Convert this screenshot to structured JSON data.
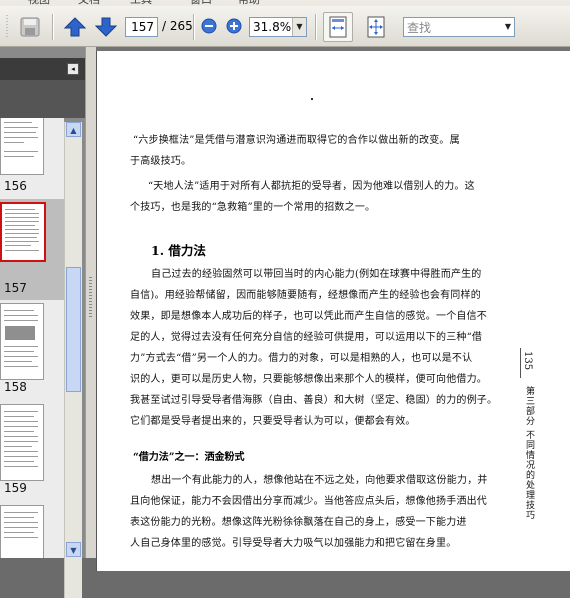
{
  "menubar": {
    "items": [
      "视图",
      "文档",
      "工具",
      "窗口",
      "帮助"
    ]
  },
  "toolbar": {
    "page_number": "157",
    "page_total": "/ 265",
    "zoom": "31.8%",
    "find_placeholder": "查找",
    "icons": [
      "disk-icon",
      "arrow-up-icon",
      "arrow-down-icon",
      "zoom-out-icon",
      "zoom-in-icon",
      "fit-width-icon",
      "fit-page-icon"
    ]
  },
  "colors": {
    "arrow_blue": "#2e63c9",
    "selection_red": "#d01010",
    "panel_dark": "#3b3b3b"
  },
  "thumbnails": [
    {
      "label": "156"
    },
    {
      "label": "157"
    },
    {
      "label": "158"
    },
    {
      "label": "159"
    }
  ],
  "document": {
    "lines": [
      "“六步换框法”是凭借与潜意识沟通进而取得它的合作以做出新的改变。属",
      "于高级技巧。",
      "“天地人法”适用于对所有人都抗拒的受导者，因为他难以借别人的力。这",
      "个技巧，也是我的“急救箱”里的一个常用的招数之一。",
      "自己过去的经验固然可以带回当时的内心能力(例如在球赛中得胜而产生的",
      "自信)。用经验帮储留，因而能够随要随有，经想像而产生的经验也会有同样的",
      "效果，即是想像本人成功后的样子，也可以凭此而产生自信的感觉。一个自信不",
      "足的人，觉得过去没有任何充分自信的经验可供提用，可以运用以下的三种“借",
      "力”方式去“借”另一个人的力。借力的对象，可以是相熟的人，也可以是不认",
      "识的人，更可以是历史人物，只要能够想像出来那个人的模样，便可向他借力。",
      "我甚至试过引导受导者借海豚（自由、善良）和大树（坚定、稳固）的力的例子。",
      "它们都是受导者提出来的，只要受导者认为可以，便都会有效。",
      "想出一个有此能力的人，想像他站在不远之处，向他要求借取这份能力，并",
      "且向他保证，能力不会因借出分享而减少。当他答应点头后，想像他扬手洒出代",
      "表这份能力的光粉。想像这阵光粉徐徐飘落在自己的身上，感受一下能力进",
      "人自己身体里的感觉。引导受导者大力吸气以加强能力和把它留在身里。"
    ],
    "heading": "1. 借力法",
    "subheading": "“借力法”之一：洒金粉式",
    "side_page_number": "135",
    "side_text": "第三部分 不同情况的处理技巧"
  }
}
